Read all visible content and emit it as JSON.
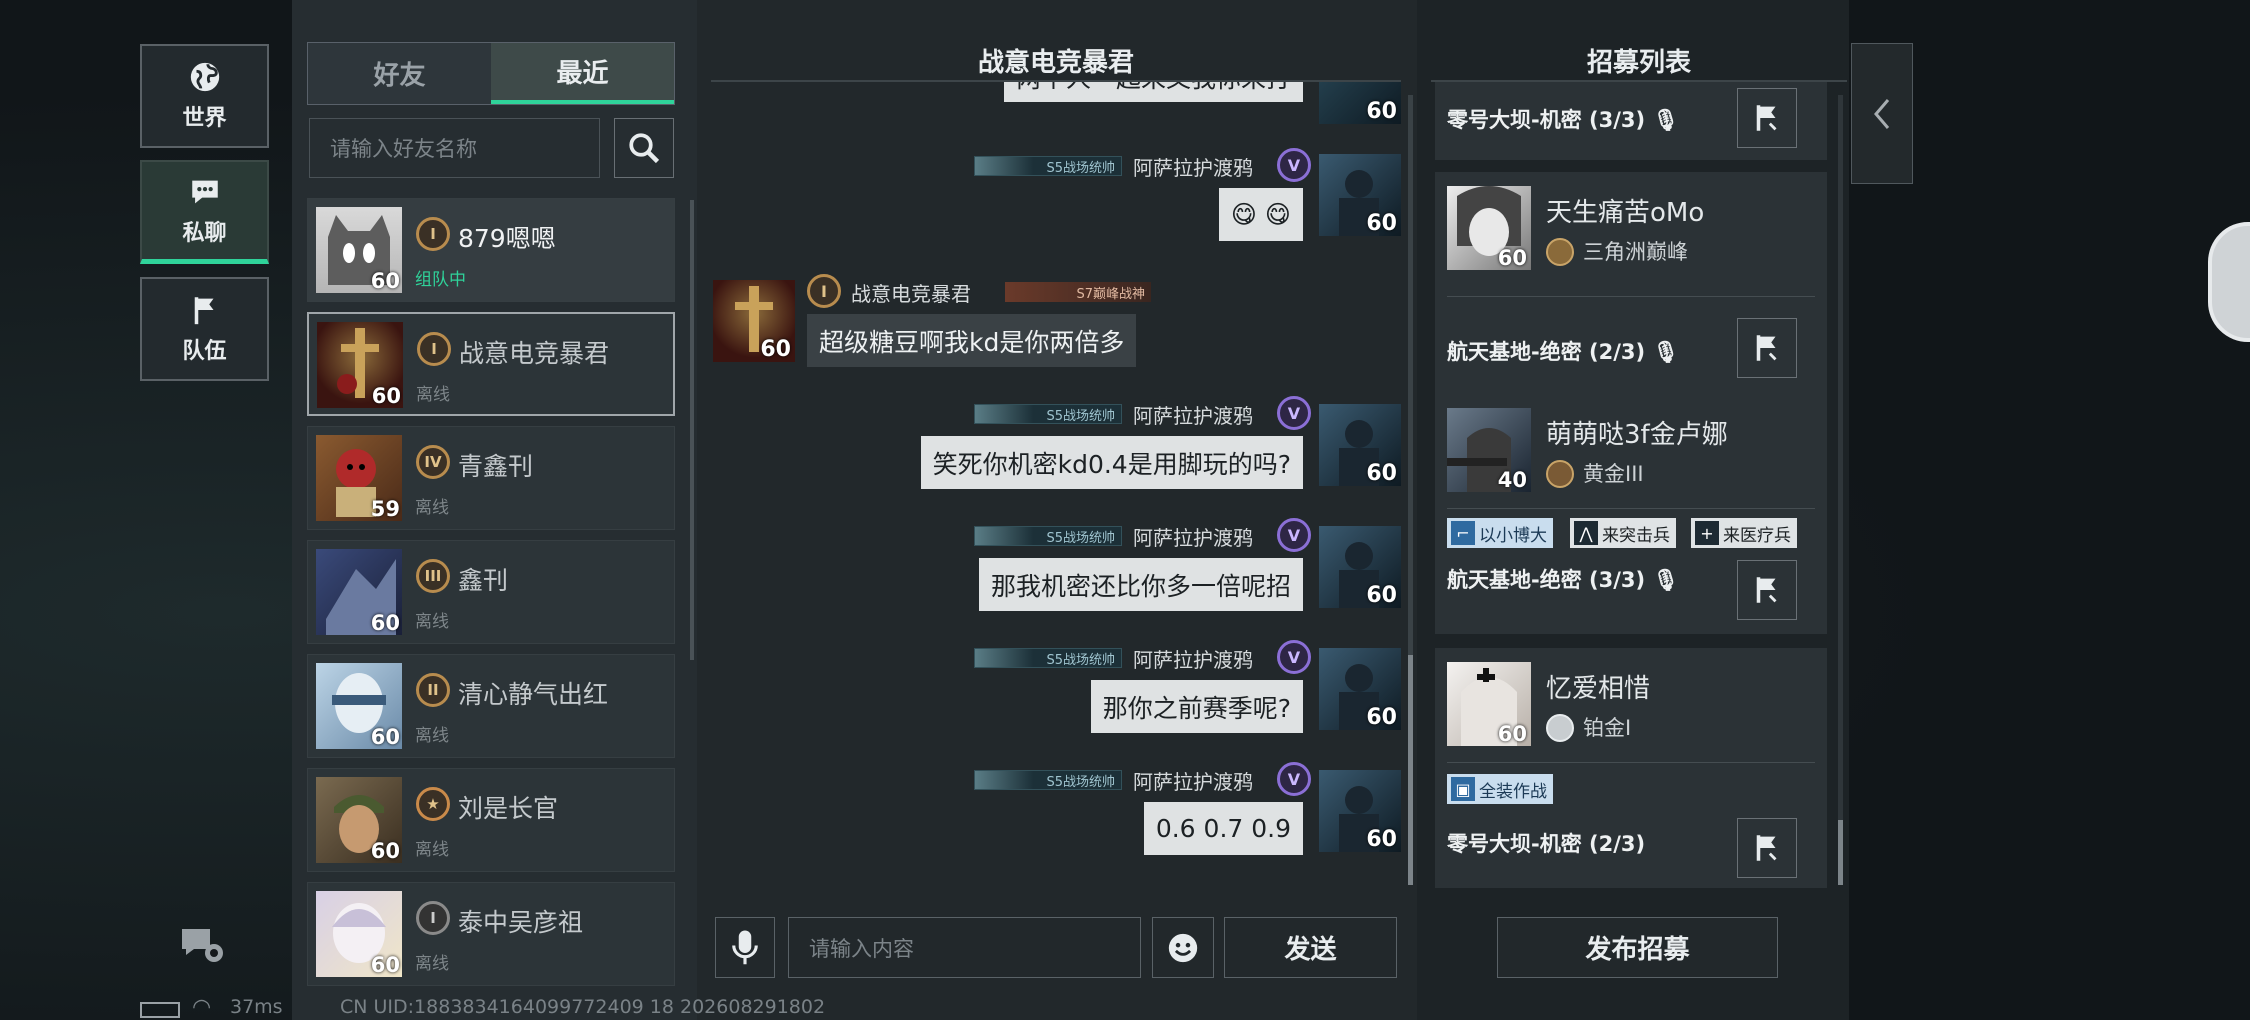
{
  "nav": {
    "world_label": "世界",
    "private_label": "私聊",
    "team_label": "队伍"
  },
  "friends": {
    "tab_friends": "好友",
    "tab_recent": "最近",
    "search_placeholder": "请输入好友名称",
    "items": [
      {
        "name": "879嗯嗯",
        "status": "组队中",
        "level": "60",
        "rank": "I"
      },
      {
        "name": "战意电竞暴君",
        "status": "离线",
        "level": "60",
        "rank": "I"
      },
      {
        "name": "青鑫刊",
        "status": "离线",
        "level": "59",
        "rank": "IV"
      },
      {
        "name": "鑫刊",
        "status": "离线",
        "level": "60",
        "rank": "III"
      },
      {
        "name": "清心静气出红",
        "status": "离线",
        "level": "60",
        "rank": "II"
      },
      {
        "name": "刘是长官",
        "status": "离线",
        "level": "60",
        "rank": ""
      },
      {
        "name": "泰中吴彦祖",
        "status": "离线",
        "level": "60",
        "rank": "I"
      }
    ]
  },
  "chat": {
    "title": "战意电竞暴君",
    "top_partial_text": "两个人一起来又我你来打",
    "top_partial_level": "60",
    "messages": [
      {
        "sender": "阿萨拉护渡鸦",
        "tag": "S5战场统帅",
        "text": "😋 😋",
        "level": "60",
        "rank": "V",
        "mine": true
      },
      {
        "sender": "战意电竞暴君",
        "tag": "S7巅峰战神",
        "text": "超级糖豆啊我kd是你两倍多",
        "level": "60",
        "rank": "I",
        "mine": false
      },
      {
        "sender": "阿萨拉护渡鸦",
        "tag": "S5战场统帅",
        "text": "笑死你机密kd0.4是用脚玩的吗?",
        "level": "60",
        "rank": "V",
        "mine": true
      },
      {
        "sender": "阿萨拉护渡鸦",
        "tag": "S5战场统帅",
        "text": "那我机密还比你多一倍呢招",
        "level": "60",
        "rank": "V",
        "mine": true
      },
      {
        "sender": "阿萨拉护渡鸦",
        "tag": "S5战场统帅",
        "text": "那你之前赛季呢?",
        "level": "60",
        "rank": "V",
        "mine": true
      },
      {
        "sender": "阿萨拉护渡鸦",
        "tag": "S5战场统帅",
        "text": "0.6 0.7 0.9",
        "level": "60",
        "rank": "V",
        "mine": true
      }
    ],
    "input_placeholder": "请输入内容",
    "send_label": "发送"
  },
  "recruit": {
    "title": "招募列表",
    "top_mode": "零号大坝-机密 (3/3)",
    "cards": [
      {
        "name": "天生痛苦oMo",
        "rank": "三角洲巅峰",
        "level": "60",
        "mode": "航天基地-绝密 (2/3)",
        "chips": []
      },
      {
        "name": "萌萌哒3f金卢娜",
        "rank": "黄金III",
        "level": "40",
        "mode": "航天基地-绝密 (3/3)",
        "chips": [
          "以小博大",
          "来突击兵",
          "来医疗兵"
        ]
      },
      {
        "name": "忆爱相惜",
        "rank": "铂金I",
        "level": "60",
        "mode": "零号大坝-机密 (2/3)",
        "chips": [
          "全装作战"
        ]
      }
    ],
    "publish_label": "发布招募"
  },
  "status": {
    "ping": "37ms",
    "uid": "CN UID:1883834164099772409 18 202608291802"
  },
  "colors": {
    "accent": "#2fd39a",
    "bubble": "#dfe2e3",
    "panel": "#262d31"
  }
}
